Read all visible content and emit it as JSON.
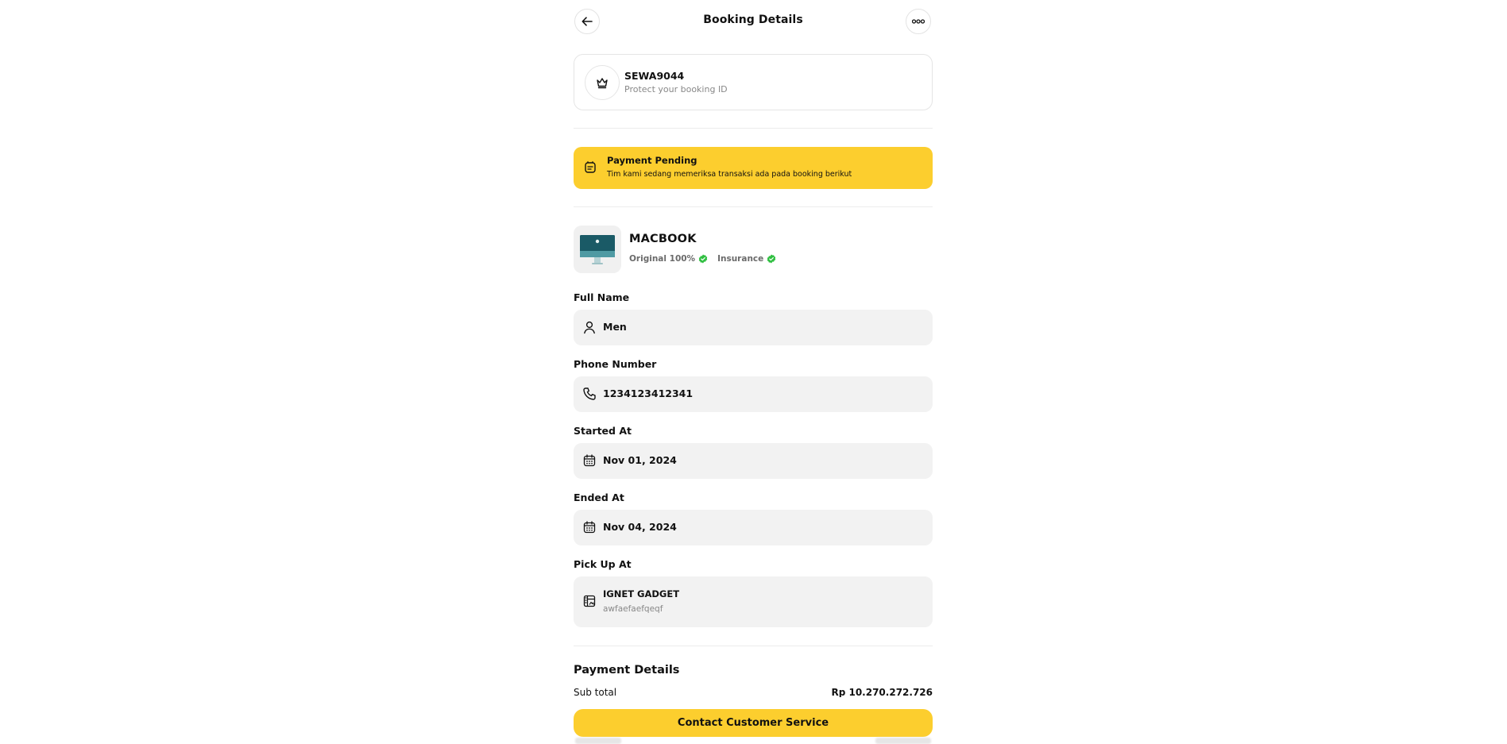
{
  "header": {
    "title": "Booking Details"
  },
  "booking": {
    "code": "SEWA9044",
    "hint": "Protect your booking ID"
  },
  "status": {
    "title": "Payment Pending",
    "message": "Tim kami sedang memeriksa transaksi ada pada booking berikut"
  },
  "product": {
    "name": "MACBOOK",
    "badges": [
      "Original 100%",
      "Insurance"
    ]
  },
  "fields": {
    "full_name": {
      "label": "Full Name",
      "value": "Men"
    },
    "phone": {
      "label": "Phone Number",
      "value": "1234123412341"
    },
    "started": {
      "label": "Started At",
      "value": "Nov 01, 2024"
    },
    "ended": {
      "label": "Ended At",
      "value": "Nov 04, 2024"
    },
    "pickup": {
      "label": "Pick Up At",
      "value": "IGNET GADGET",
      "address": "awfaefaefqeqf"
    }
  },
  "payment": {
    "title": "Payment Details",
    "subtotal_label": "Sub total",
    "subtotal_value": "Rp 10.270.272.726"
  },
  "cta": {
    "label": "Contact Customer Service"
  },
  "colors": {
    "accent": "#fcce2e",
    "success": "#2fbf40",
    "field_bg": "#f2f2f2"
  }
}
